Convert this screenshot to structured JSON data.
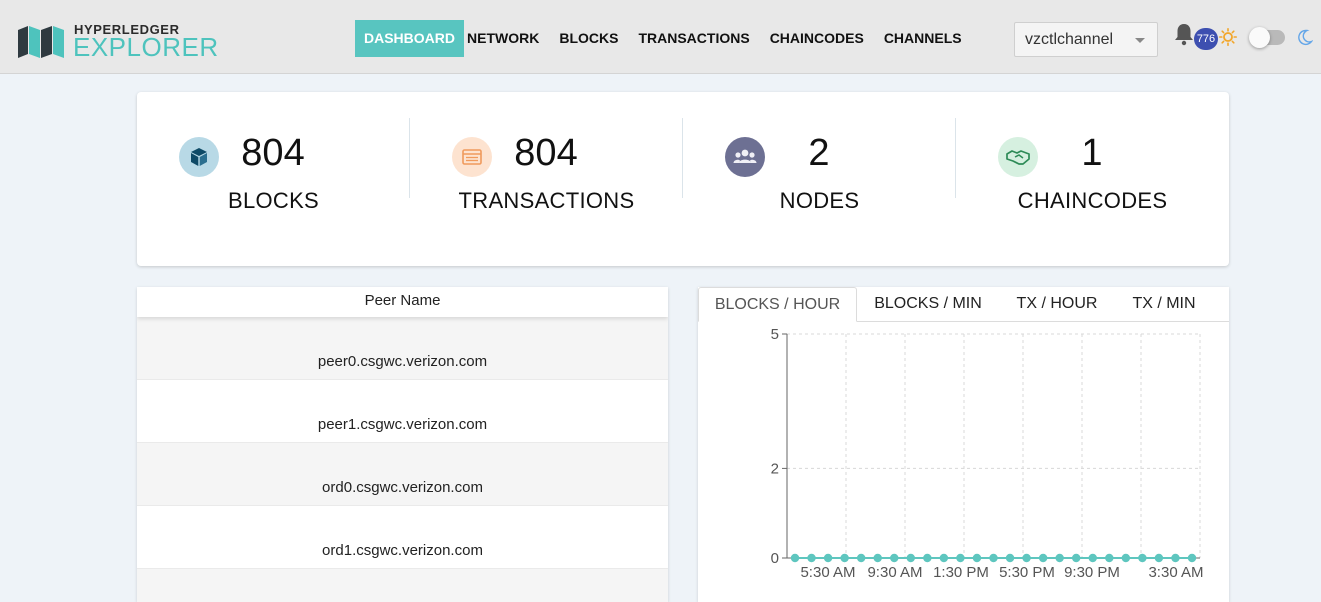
{
  "header": {
    "logo_top": "HYPERLEDGER",
    "logo_bottom": "EXPLORER",
    "nav": [
      {
        "label": "DASHBOARD",
        "active": true
      },
      {
        "label": "NETWORK",
        "active": false
      },
      {
        "label": "BLOCKS",
        "active": false
      },
      {
        "label": "TRANSACTIONS",
        "active": false
      },
      {
        "label": "CHAINCODES",
        "active": false
      },
      {
        "label": "CHANNELS",
        "active": false
      }
    ],
    "channel": "vzctlchannel",
    "notification_count": "776",
    "icons": [
      "bell-icon",
      "sun-icon",
      "theme-toggle",
      "moon-icon"
    ]
  },
  "stats": [
    {
      "value": "804",
      "label": "BLOCKS",
      "icon": "cube-icon",
      "icon_bg": "#b8d9e6",
      "icon_fg": "#0e4a66"
    },
    {
      "value": "804",
      "label": "TRANSACTIONS",
      "icon": "list-icon",
      "icon_bg": "#fde3d0",
      "icon_fg": "#f09a5c"
    },
    {
      "value": "2",
      "label": "NODES",
      "icon": "users-icon",
      "icon_bg": "#6d7093",
      "icon_fg": "#f0f0f6"
    },
    {
      "value": "1",
      "label": "CHAINCODES",
      "icon": "handshake-icon",
      "icon_bg": "#d6f0e0",
      "icon_fg": "#2e8b57"
    }
  ],
  "peers": {
    "header": "Peer Name",
    "rows": [
      "peer0.csgwc.verizon.com",
      "peer1.csgwc.verizon.com",
      "ord0.csgwc.verizon.com",
      "ord1.csgwc.verizon.com"
    ]
  },
  "chart_tabs": [
    {
      "label": "BLOCKS / HOUR",
      "active": true
    },
    {
      "label": "BLOCKS / MIN",
      "active": false
    },
    {
      "label": "TX / HOUR",
      "active": false
    },
    {
      "label": "TX / MIN",
      "active": false
    }
  ],
  "colors": {
    "accent": "#58c5c0",
    "badge": "#3d4fb0",
    "line": "#5ec6bf"
  },
  "chart_data": {
    "type": "line",
    "title": "",
    "xlabel": "",
    "ylabel": "",
    "ylim": [
      0,
      5
    ],
    "yticks": [
      0,
      2,
      5
    ],
    "x_tick_labels": [
      "5:30 AM",
      "9:30 AM",
      "1:30 PM",
      "5:30 PM",
      "9:30 PM",
      "3:30 AM"
    ],
    "grid": true,
    "series": [
      {
        "values": [
          0,
          0,
          0,
          0,
          0,
          0,
          0,
          0,
          0,
          0,
          0,
          0,
          0,
          0,
          0,
          0,
          0,
          0,
          0,
          0,
          0,
          0,
          0,
          0,
          0
        ]
      }
    ]
  }
}
